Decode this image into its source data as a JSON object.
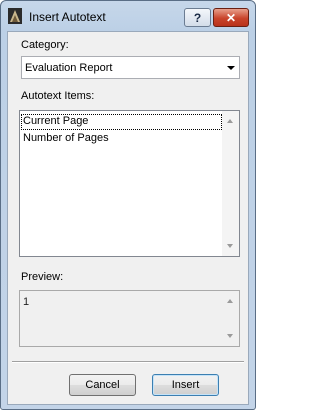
{
  "window": {
    "title": "Insert Autotext"
  },
  "titlebar": {
    "help_label": "?",
    "close_label": "✕"
  },
  "category": {
    "label": "Category:",
    "selected": "Evaluation Report"
  },
  "autotext": {
    "label": "Autotext Items:",
    "items": [
      "Current Page",
      "Number of Pages"
    ],
    "selected_index": 0
  },
  "preview": {
    "label": "Preview:",
    "value": "1"
  },
  "buttons": {
    "cancel": "Cancel",
    "insert": "Insert"
  },
  "icons": {
    "app": "app-icon",
    "help": "help-icon",
    "close": "close-icon",
    "dropdown": "chevron-down-icon"
  },
  "colors": {
    "title_bar": "#bcd0e6",
    "close_button": "#c9442b",
    "default_button_border": "#3c7fb1"
  }
}
